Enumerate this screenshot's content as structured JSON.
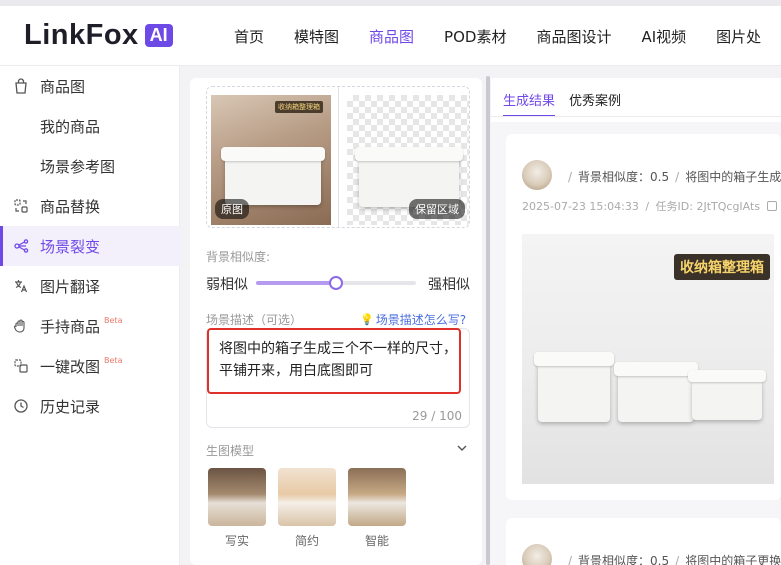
{
  "brand": {
    "name": "LinkFox",
    "badge": "AI"
  },
  "nav": {
    "items": [
      "首页",
      "模特图",
      "商品图",
      "POD素材",
      "商品图设计",
      "AI视频",
      "图片处"
    ],
    "active_index": 2
  },
  "sidebar": {
    "items": [
      {
        "label": "商品图",
        "icon": "bag-icon",
        "sub": false
      },
      {
        "label": "我的商品",
        "sub": true
      },
      {
        "label": "场景参考图",
        "sub": true
      },
      {
        "label": "商品替换",
        "icon": "swap-icon",
        "sub": false
      },
      {
        "label": "场景裂变",
        "icon": "fission-icon",
        "sub": false,
        "active": true
      },
      {
        "label": "图片翻译",
        "icon": "translate-icon",
        "sub": false
      },
      {
        "label": "手持商品",
        "icon": "hand-icon",
        "sub": false,
        "beta": "Beta"
      },
      {
        "label": "一键改图",
        "icon": "edit-image-icon",
        "sub": false,
        "beta": "Beta"
      },
      {
        "label": "历史记录",
        "icon": "history-icon",
        "sub": false
      }
    ]
  },
  "editor": {
    "images": {
      "original_label": "原图",
      "kept_label": "保留区域",
      "product_banner": "收纳箱整理箱"
    },
    "similarity": {
      "label": "背景相似度:",
      "low_label": "弱相似",
      "high_label": "强相似",
      "value": 0.5
    },
    "description": {
      "label": "场景描述（可选）",
      "help_link": "场景描述怎么写?",
      "text": "将图中的箱子生成三个不一样的尺寸，平铺开来，用白底图即可",
      "count": "29 / 100"
    },
    "model": {
      "label": "生图模型",
      "options": [
        {
          "label": "写实"
        },
        {
          "label": "简约"
        },
        {
          "label": "智能"
        }
      ]
    }
  },
  "results": {
    "tabs": [
      "生成结果",
      "优秀案例"
    ],
    "active_tab": 0,
    "cards": [
      {
        "similarity": "背景相似度：0.5",
        "prompt": "将图中的箱子生成",
        "timestamp": "2025-07-23 15:04:33",
        "task_id": "任务ID: 2JtTQcgIAts",
        "image_banner": "收纳箱整理箱"
      },
      {
        "similarity": "背景相似度：0.5",
        "prompt": "将图中的箱子更换"
      }
    ]
  },
  "colors": {
    "accent": "#7048e8",
    "highlight_border": "#e0302a",
    "link": "#4a6fdc"
  }
}
